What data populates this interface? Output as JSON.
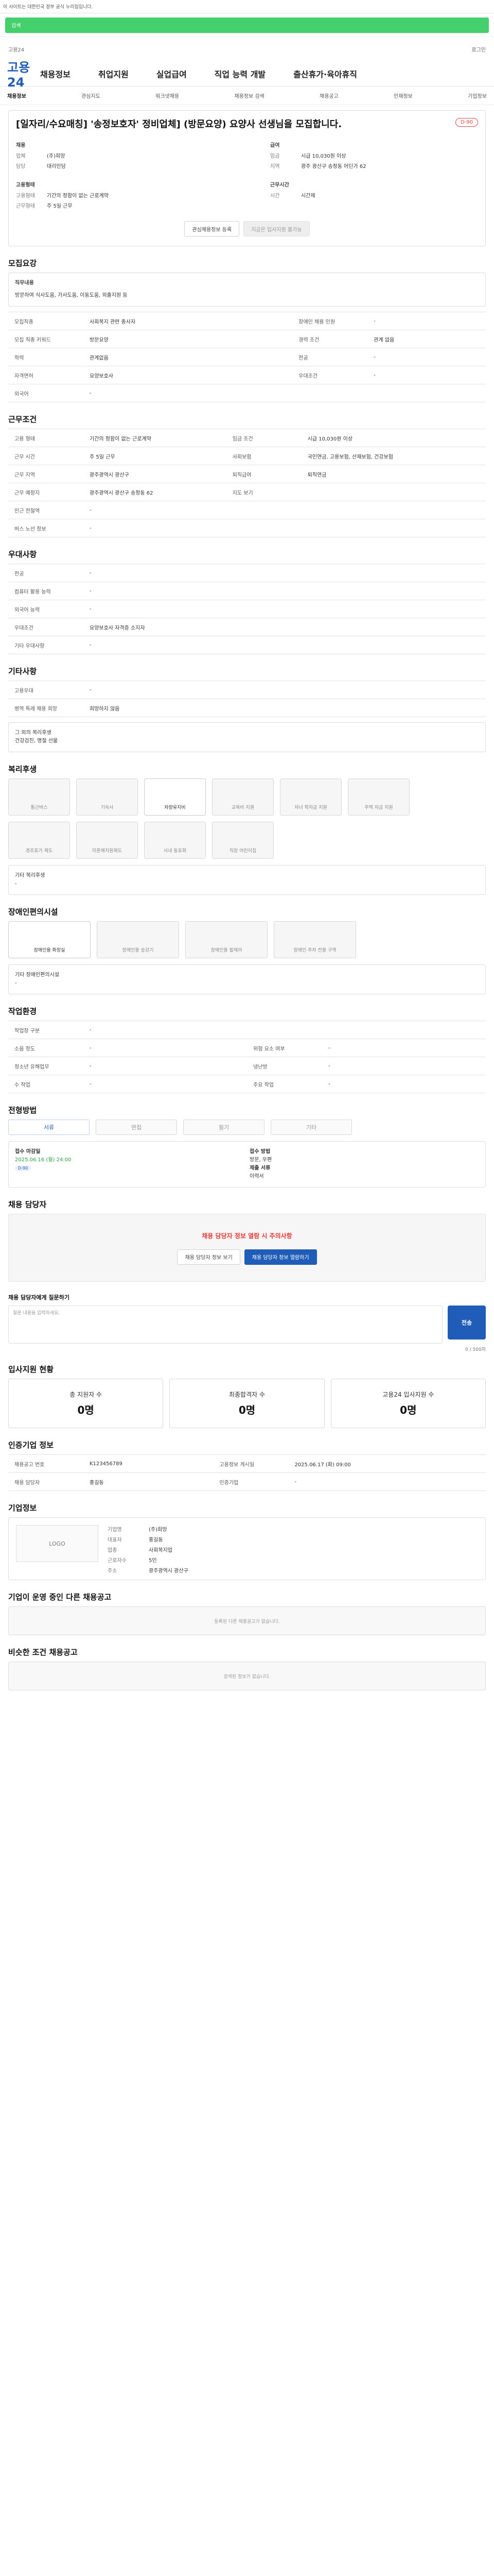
{
  "top": {
    "notice": "이 사이트는 대한민국 정부 공식 누리집입니다.",
    "searchHint": "검색"
  },
  "nav": {
    "logo": "고용24",
    "items": [
      "채용정보",
      "취업지원",
      "실업급여",
      "직업 능력 개발",
      "출산휴가·육아휴직"
    ],
    "subitems": [
      "채용정보",
      "관심지도",
      "워크넷채용",
      "채용정보 검색",
      "채용공고",
      "인재정보",
      "기업정보"
    ]
  },
  "job": {
    "title": "[일자리/수요매칭] '송정보호자' 정비업체] (방문요양) 요양사 선생님을 모집합니다.",
    "dday": "D-90",
    "employer": "채용",
    "company": "(주)희망",
    "contact": "대리인담",
    "salaryLabel": "급여",
    "salary": "시급 10,030원 이상",
    "workplace": "광주 광산구 송정동 어딘가 62",
    "employmentType": "기간의 정함이 없는 근로계약",
    "workType": "주 5일 근무",
    "workHours": "시간제",
    "share": "관심채용정보 등록",
    "apply": "지금은 입사지원 불가능"
  },
  "sections": {
    "overview": "모집요강",
    "recruitment": "모집요강",
    "duty": "직무내용",
    "dutyText": "방문하여 식사도움, 가사도움, 이동도움, 외출지원 등",
    "conditions": "근무조건",
    "welfare": "복리후생",
    "disabled": "장애인편의시설",
    "workplaceEnv": "작업환경",
    "process": "전형방법",
    "contactTitle": "채용 담당자",
    "contactQuestion": "채용 담당자에게 질문하기",
    "applyStatus": "입사지원 현황",
    "notice": "인증기업 정보",
    "companyInfo": "기업정보",
    "related": "기업이 운영 중인 다른 채용공고",
    "other": "비슷한 조건 채용공고"
  },
  "recruitRows": [
    [
      "모집직종",
      "사회복지 관련 종사자",
      "장애인 채용 인원",
      "-"
    ],
    [
      "모집 직종 키워드",
      "방문요양",
      "경력 조건",
      "관계 없음"
    ],
    [
      "학력",
      "관계없음",
      "전공",
      "-"
    ],
    [
      "자격면허",
      "요양보호사",
      "우대조건",
      "-"
    ],
    [
      "외국어",
      "-",
      "-",
      "-"
    ]
  ],
  "conditionRows": [
    [
      "고용 형태",
      "기간의 정함이 없는 근로계약",
      "임금 조건",
      "시급 10,030원 이상"
    ],
    [
      "근무 시간",
      "주 5일 근무",
      "사회보험",
      "국민연금, 고용보험, 산재보험, 건강보험"
    ],
    [
      "근무 지역",
      "광주광역시 광산구",
      "퇴직급여",
      "퇴직연금"
    ],
    [
      "근무 예정지",
      "광주광역시 광산구 송정동 62",
      "지도 보기",
      "-"
    ],
    [
      "인근 전철역",
      "-",
      "-",
      "-"
    ],
    [
      "버스 노선 정보",
      "-",
      "-",
      "-"
    ]
  ],
  "preferredRows": [
    [
      "전공",
      "-"
    ],
    [
      "컴퓨터 활용 능력",
      "-"
    ],
    [
      "외국어 능력",
      "-"
    ],
    [
      "우대조건",
      "요양보호사 자격증 소지자"
    ],
    [
      "기타 우대사항",
      "-"
    ]
  ],
  "otherRows": [
    [
      "고용우대",
      "-"
    ],
    [
      "병역 특례 채용 희망",
      "희망하지 않음"
    ]
  ],
  "benefitsText": "그 외의 복리후생",
  "benefitsValue": "건강검진, 명절 선물",
  "welfareIcons": [
    "통근버스",
    "기숙사",
    "차량유지비",
    "교육비 지원",
    "자녀 학자금 지원",
    "주택 자금 지원",
    "경조휴가 제도",
    "미혼해지원제도",
    "사내 동호회",
    "직장 어린이집"
  ],
  "otherWelfareLabel": "기타 복리후생",
  "disabledItems": [
    "장애인용 화장실",
    "장애인용 승강기",
    "장애인용 휠체어",
    "장애인 주차 전용 구역"
  ],
  "envRows": [
    [
      "작업장 구분",
      "-",
      "",
      ""
    ],
    [
      "소음 정도",
      "-",
      "위험 요소 여부",
      "-"
    ],
    [
      "청소년 유해업무",
      "-",
      "냉난방",
      "-"
    ],
    [
      "수 작업",
      "-",
      "주요 작업",
      "-"
    ]
  ],
  "processSteps": [
    "서류",
    "면접",
    "필기",
    "기타"
  ],
  "dates": {
    "startLabel": "접수 마감일",
    "start": "2025.06.16 (월) 24:00",
    "dday": "D-90",
    "methodLabel": "접수 방법",
    "method": "방문, 우편",
    "docsLabel": "제출 서류",
    "docs": "이력서"
  },
  "contactWarn": "채용 담당자 정보 열람 시 주의사항",
  "contactButtons": [
    "채용 담당자 정보 보기",
    "채용 담당자 정보 열람하기"
  ],
  "question": "질문 내용을 입력하세요.",
  "questionCount": "0 / 500자",
  "sendLabel": "전송",
  "statsRow": [
    {
      "label": "총 지원자 수",
      "value": "0명"
    },
    {
      "label": "최종합격자 수",
      "value": "0명"
    },
    {
      "label": "고용24 입사지원 수",
      "value": "0명"
    }
  ],
  "infoRows": [
    [
      "채용공고 번호",
      "K123456789",
      "고용정보 게시일",
      "2025.06.17 (화) 09:00"
    ],
    [
      "채용 담당자",
      "홍길동",
      "인증기업",
      "-"
    ]
  ],
  "company": {
    "logoText": "LOGO",
    "name": "(주)희망",
    "ceo": "홍길동",
    "type": "사회복지업",
    "size": "5인",
    "address": "광주광역시 광산구",
    "homepage": "-"
  },
  "relatedEmpty": "등록된 다른 채용공고가 없습니다.",
  "otherEmpty": "검색된 정보가 없습니다."
}
